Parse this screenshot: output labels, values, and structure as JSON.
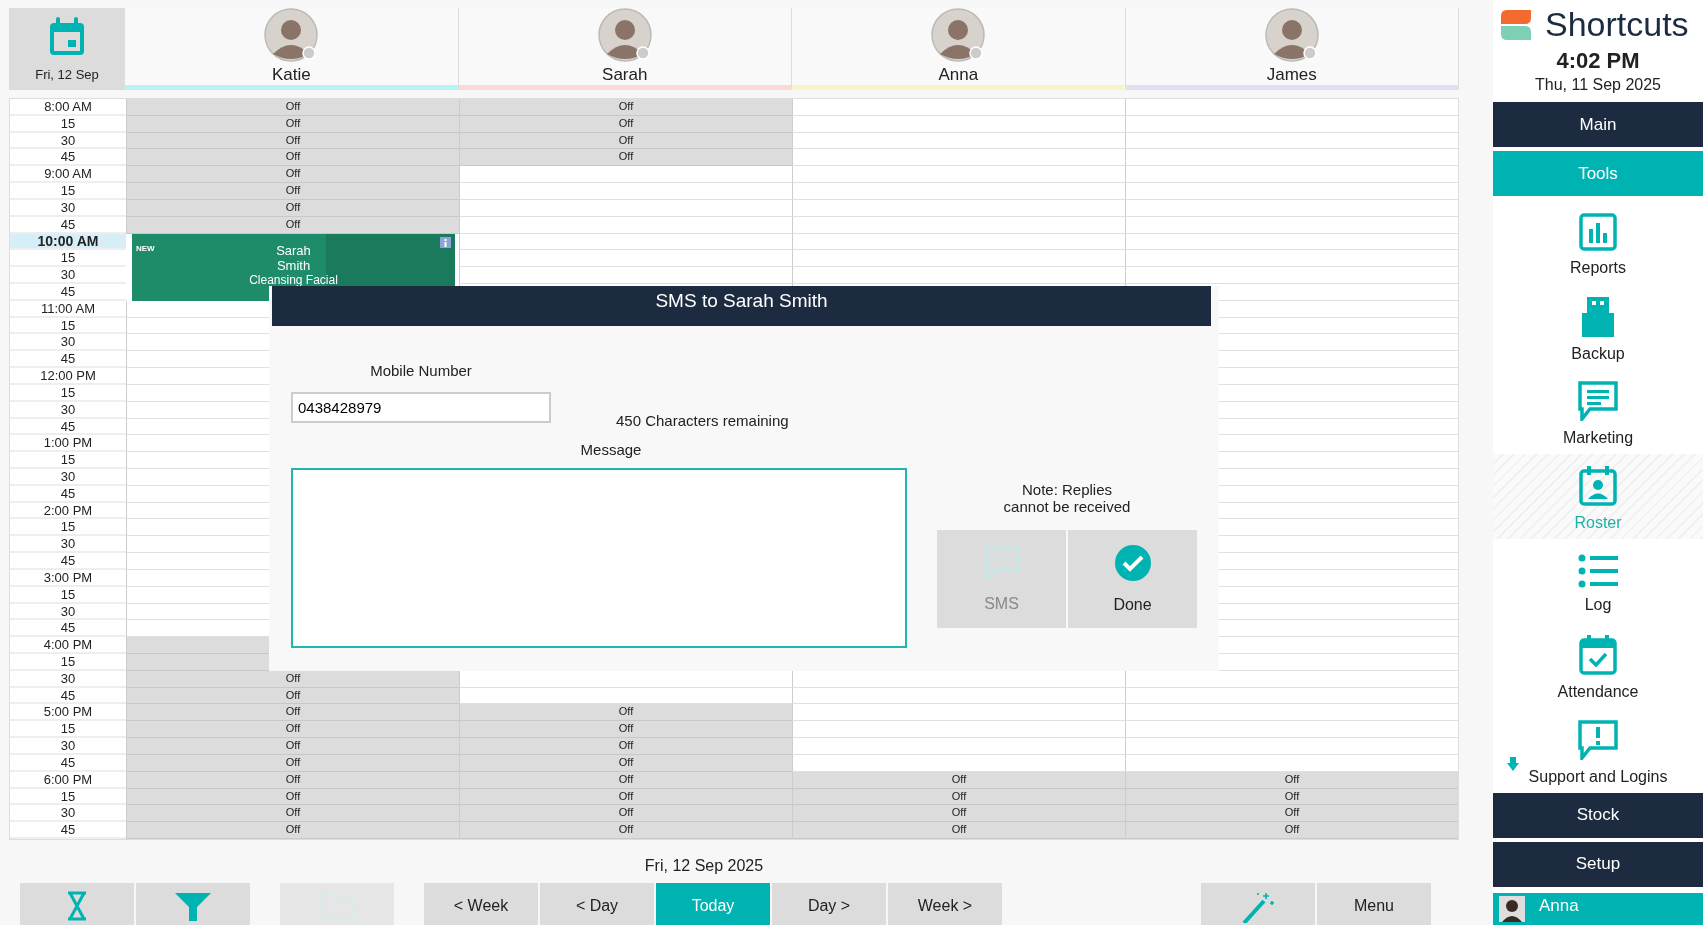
{
  "calendar": {
    "date_label": "Fri, 12 Sep",
    "staff": [
      {
        "name": "Katie",
        "color": "#b8f4f6"
      },
      {
        "name": "Sarah",
        "color": "#fbd9d6"
      },
      {
        "name": "Anna",
        "color": "#f8f4c8"
      },
      {
        "name": "James",
        "color": "#e0e0f2"
      }
    ],
    "rows": [
      {
        "time": "8:00 AM",
        "selected": false,
        "cells": [
          {
            "off": true,
            "text": "Off"
          },
          {
            "off": true,
            "text": "Off"
          },
          {
            "off": false
          },
          {
            "off": false
          }
        ]
      },
      {
        "time": "15",
        "selected": false,
        "cells": [
          {
            "off": true,
            "text": "Off"
          },
          {
            "off": true,
            "text": "Off"
          },
          {
            "off": false
          },
          {
            "off": false
          }
        ]
      },
      {
        "time": "30",
        "selected": false,
        "cells": [
          {
            "off": true,
            "text": "Off"
          },
          {
            "off": true,
            "text": "Off"
          },
          {
            "off": false
          },
          {
            "off": false
          }
        ]
      },
      {
        "time": "45",
        "selected": false,
        "cells": [
          {
            "off": true,
            "text": "Off"
          },
          {
            "off": true,
            "text": "Off"
          },
          {
            "off": false
          },
          {
            "off": false
          }
        ]
      },
      {
        "time": "9:00 AM",
        "selected": false,
        "cells": [
          {
            "off": true,
            "text": "Off"
          },
          {
            "off": false
          },
          {
            "off": false
          },
          {
            "off": false
          }
        ]
      },
      {
        "time": "15",
        "selected": false,
        "cells": [
          {
            "off": true,
            "text": "Off"
          },
          {
            "off": false
          },
          {
            "off": false
          },
          {
            "off": false
          }
        ]
      },
      {
        "time": "30",
        "selected": false,
        "cells": [
          {
            "off": true,
            "text": "Off"
          },
          {
            "off": false
          },
          {
            "off": false
          },
          {
            "off": false
          }
        ]
      },
      {
        "time": "45",
        "selected": false,
        "cells": [
          {
            "off": true,
            "text": "Off"
          },
          {
            "off": false
          },
          {
            "off": false
          },
          {
            "off": false
          }
        ]
      },
      {
        "time": "10:00 AM",
        "selected": true,
        "cells": [
          null,
          {
            "off": false
          },
          {
            "off": false
          },
          {
            "off": false
          }
        ]
      },
      {
        "time": "15",
        "selected": false,
        "cells": [
          null,
          {
            "off": false
          },
          {
            "off": false
          },
          {
            "off": false
          }
        ]
      },
      {
        "time": "30",
        "selected": false,
        "cells": [
          null,
          {
            "off": false
          },
          {
            "off": false
          },
          {
            "off": false
          }
        ]
      },
      {
        "time": "45",
        "selected": false,
        "cells": [
          null,
          {
            "off": false
          },
          {
            "off": false
          },
          {
            "off": false
          }
        ]
      },
      {
        "time": "11:00 AM",
        "selected": false,
        "cells": [
          {
            "off": false
          },
          null,
          null,
          {
            "off": false
          }
        ]
      },
      {
        "time": "15",
        "selected": false,
        "cells": [
          {
            "off": false
          },
          null,
          null,
          {
            "off": false
          }
        ]
      },
      {
        "time": "30",
        "selected": false,
        "cells": [
          {
            "off": false
          },
          null,
          null,
          {
            "off": false
          }
        ]
      },
      {
        "time": "45",
        "selected": false,
        "cells": [
          {
            "off": false
          },
          null,
          null,
          {
            "off": false
          }
        ]
      },
      {
        "time": "12:00 PM",
        "selected": false,
        "cells": [
          {
            "off": false
          },
          null,
          null,
          {
            "off": false
          }
        ]
      },
      {
        "time": "15",
        "selected": false,
        "cells": [
          {
            "off": false
          },
          null,
          null,
          {
            "off": false
          }
        ]
      },
      {
        "time": "30",
        "selected": false,
        "cells": [
          {
            "off": false
          },
          null,
          null,
          {
            "off": false
          }
        ]
      },
      {
        "time": "45",
        "selected": false,
        "cells": [
          {
            "off": false
          },
          null,
          null,
          {
            "off": false
          }
        ]
      },
      {
        "time": "1:00 PM",
        "selected": false,
        "cells": [
          {
            "off": false
          },
          null,
          null,
          {
            "off": false
          }
        ]
      },
      {
        "time": "15",
        "selected": false,
        "cells": [
          {
            "off": false
          },
          null,
          null,
          {
            "off": false
          }
        ]
      },
      {
        "time": "30",
        "selected": false,
        "cells": [
          {
            "off": false
          },
          null,
          null,
          {
            "off": false
          }
        ]
      },
      {
        "time": "45",
        "selected": false,
        "cells": [
          {
            "off": false
          },
          null,
          null,
          {
            "off": false
          }
        ]
      },
      {
        "time": "2:00 PM",
        "selected": false,
        "cells": [
          {
            "off": false
          },
          null,
          null,
          {
            "off": false
          }
        ]
      },
      {
        "time": "15",
        "selected": false,
        "cells": [
          {
            "off": false
          },
          null,
          null,
          {
            "off": false
          }
        ]
      },
      {
        "time": "30",
        "selected": false,
        "cells": [
          {
            "off": false
          },
          null,
          null,
          {
            "off": false
          }
        ]
      },
      {
        "time": "45",
        "selected": false,
        "cells": [
          {
            "off": false
          },
          null,
          null,
          {
            "off": false
          }
        ]
      },
      {
        "time": "3:00 PM",
        "selected": false,
        "cells": [
          {
            "off": false
          },
          null,
          null,
          {
            "off": false
          }
        ]
      },
      {
        "time": "15",
        "selected": false,
        "cells": [
          {
            "off": false
          },
          null,
          null,
          {
            "off": false
          }
        ]
      },
      {
        "time": "30",
        "selected": false,
        "cells": [
          {
            "off": false
          },
          null,
          null,
          {
            "off": false
          }
        ]
      },
      {
        "time": "45",
        "selected": false,
        "cells": [
          {
            "off": false
          },
          null,
          null,
          {
            "off": false
          }
        ]
      },
      {
        "time": "4:00 PM",
        "selected": false,
        "cells": [
          {
            "off": true
          },
          null,
          null,
          {
            "off": false
          }
        ]
      },
      {
        "time": "15",
        "selected": false,
        "cells": [
          {
            "off": true
          },
          null,
          null,
          {
            "off": false
          }
        ]
      },
      {
        "time": "30",
        "selected": false,
        "cells": [
          {
            "off": true,
            "text": "Off"
          },
          {
            "off": false
          },
          {
            "off": false
          },
          {
            "off": false
          }
        ]
      },
      {
        "time": "45",
        "selected": false,
        "cells": [
          {
            "off": true,
            "text": "Off"
          },
          {
            "off": false
          },
          {
            "off": false
          },
          {
            "off": false
          }
        ]
      },
      {
        "time": "5:00 PM",
        "selected": false,
        "cells": [
          {
            "off": true,
            "text": "Off"
          },
          {
            "off": true,
            "text": "Off"
          },
          {
            "off": false
          },
          {
            "off": false
          }
        ]
      },
      {
        "time": "15",
        "selected": false,
        "cells": [
          {
            "off": true,
            "text": "Off"
          },
          {
            "off": true,
            "text": "Off"
          },
          {
            "off": false
          },
          {
            "off": false
          }
        ]
      },
      {
        "time": "30",
        "selected": false,
        "cells": [
          {
            "off": true,
            "text": "Off"
          },
          {
            "off": true,
            "text": "Off"
          },
          {
            "off": false
          },
          {
            "off": false
          }
        ]
      },
      {
        "time": "45",
        "selected": false,
        "cells": [
          {
            "off": true,
            "text": "Off"
          },
          {
            "off": true,
            "text": "Off"
          },
          {
            "off": false
          },
          {
            "off": false
          }
        ]
      },
      {
        "time": "6:00 PM",
        "selected": false,
        "cells": [
          {
            "off": true,
            "text": "Off"
          },
          {
            "off": true,
            "text": "Off"
          },
          {
            "off": true,
            "text": "Off"
          },
          {
            "off": true,
            "text": "Off"
          }
        ]
      },
      {
        "time": "15",
        "selected": false,
        "cells": [
          {
            "off": true,
            "text": "Off"
          },
          {
            "off": true,
            "text": "Off"
          },
          {
            "off": true,
            "text": "Off"
          },
          {
            "off": true,
            "text": "Off"
          }
        ]
      },
      {
        "time": "30",
        "selected": false,
        "cells": [
          {
            "off": true,
            "text": "Off"
          },
          {
            "off": true,
            "text": "Off"
          },
          {
            "off": true,
            "text": "Off"
          },
          {
            "off": true,
            "text": "Off"
          }
        ]
      },
      {
        "time": "45",
        "selected": false,
        "cells": [
          {
            "off": true,
            "text": "Off"
          },
          {
            "off": true,
            "text": "Off"
          },
          {
            "off": true,
            "text": "Off"
          },
          {
            "off": true,
            "text": "Off"
          }
        ]
      }
    ],
    "appointment": {
      "tag": "NEW",
      "client": "Sarah Smith",
      "service": "Cleansing Facial"
    }
  },
  "dialog": {
    "title": "SMS to Sarah Smith",
    "mobile_label": "Mobile Number",
    "mobile_value": "0438428979",
    "remaining": "450 Characters remaining",
    "message_label": "Message",
    "note": "Note: Replies cannot be received",
    "buttons": [
      {
        "label": "SMS",
        "kind": "sms",
        "disabled": true
      },
      {
        "label": "Done",
        "kind": "done",
        "disabled": false
      }
    ]
  },
  "footer": {
    "date": "Fri, 12 Sep 2025",
    "buttons": [
      {
        "kind": "hourglass",
        "selected": false,
        "disabled": false
      },
      {
        "kind": "filter",
        "selected": false,
        "disabled": false
      },
      {
        "kind": "folder",
        "selected": false,
        "disabled": true
      },
      {
        "kind": "text",
        "label": "< Week",
        "selected": false,
        "disabled": false
      },
      {
        "kind": "text",
        "label": "< Day",
        "selected": false,
        "disabled": false
      },
      {
        "kind": "text",
        "label": "Today",
        "selected": true,
        "disabled": false
      },
      {
        "kind": "text",
        "label": "Day >",
        "selected": false,
        "disabled": false
      },
      {
        "kind": "text",
        "label": "Week >",
        "selected": false,
        "disabled": false
      },
      {
        "kind": "wand",
        "selected": false,
        "disabled": false
      },
      {
        "kind": "text",
        "label": "Menu",
        "selected": false,
        "disabled": false
      }
    ]
  },
  "sidebar": {
    "title": "Shortcuts",
    "time": "4:02 PM",
    "date": "Thu, 11 Sep 2025",
    "items": [
      {
        "kind": "section",
        "label": "Main",
        "selected": false
      },
      {
        "kind": "section",
        "label": "Tools",
        "selected": true
      },
      {
        "kind": "shortcut",
        "label": "Reports",
        "selected": false
      },
      {
        "kind": "shortcut",
        "label": "Backup",
        "selected": false
      },
      {
        "kind": "shortcut",
        "label": "Marketing",
        "selected": false
      },
      {
        "kind": "shortcut",
        "label": "Roster",
        "selected": true
      },
      {
        "kind": "shortcut",
        "label": "Log",
        "selected": false
      },
      {
        "kind": "shortcut",
        "label": "Attendance",
        "selected": false
      },
      {
        "kind": "shortcut",
        "label": "Support and Logins",
        "selected": false
      },
      {
        "kind": "section",
        "label": "Stock",
        "selected": false
      },
      {
        "kind": "section",
        "label": "Setup",
        "selected": false
      }
    ],
    "user": "Anna"
  }
}
